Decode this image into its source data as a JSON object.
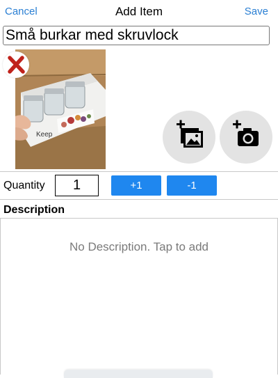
{
  "navbar": {
    "cancel_label": "Cancel",
    "title": "Add Item",
    "save_label": "Save"
  },
  "item": {
    "title_value": "Små burkar med skruvlock"
  },
  "photo": {
    "box_label": "Keep"
  },
  "quantity": {
    "label": "Quantity",
    "value": "1",
    "plus_label": "+1",
    "minus_label": "-1"
  },
  "description": {
    "header": "Description",
    "placeholder": "No Description. Tap to add"
  },
  "icons": {
    "delete": "close-x-icon",
    "add_from_gallery": "add-photo-gallery-icon",
    "add_from_camera": "add-photo-camera-icon"
  },
  "colors": {
    "accent": "#2a7fd3",
    "button": "#1f87ef",
    "delete": "#c0221b"
  }
}
